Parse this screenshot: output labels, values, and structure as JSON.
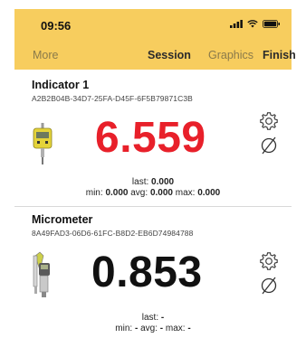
{
  "status": {
    "time": "09:56"
  },
  "nav": {
    "more": "More",
    "session": "Session",
    "graphics": "Graphics",
    "finish": "Finish"
  },
  "devices": [
    {
      "name": "Indicator 1",
      "id": "A2B2B04B-34D7-25FA-D45F-6F5B79871C3B",
      "reading": "6.559",
      "reading_color": "#e8202a",
      "last_label": "last:",
      "last": "0.000",
      "min_label": "min:",
      "min": "0.000",
      "avg_label": "avg:",
      "avg": "0.000",
      "max_label": "max:",
      "max": "0.000"
    },
    {
      "name": "Micrometer",
      "id": "8A49FAD3-06D6-61FC-B8D2-EB6D74984788",
      "reading": "0.853",
      "reading_color": "#111111",
      "last_label": "last:",
      "last": "-",
      "min_label": "min:",
      "min": "-",
      "avg_label": "avg:",
      "avg": "-",
      "max_label": "max:",
      "max": "-"
    }
  ],
  "colors": {
    "header": "#f7cd5e",
    "accent_red": "#e8202a"
  }
}
